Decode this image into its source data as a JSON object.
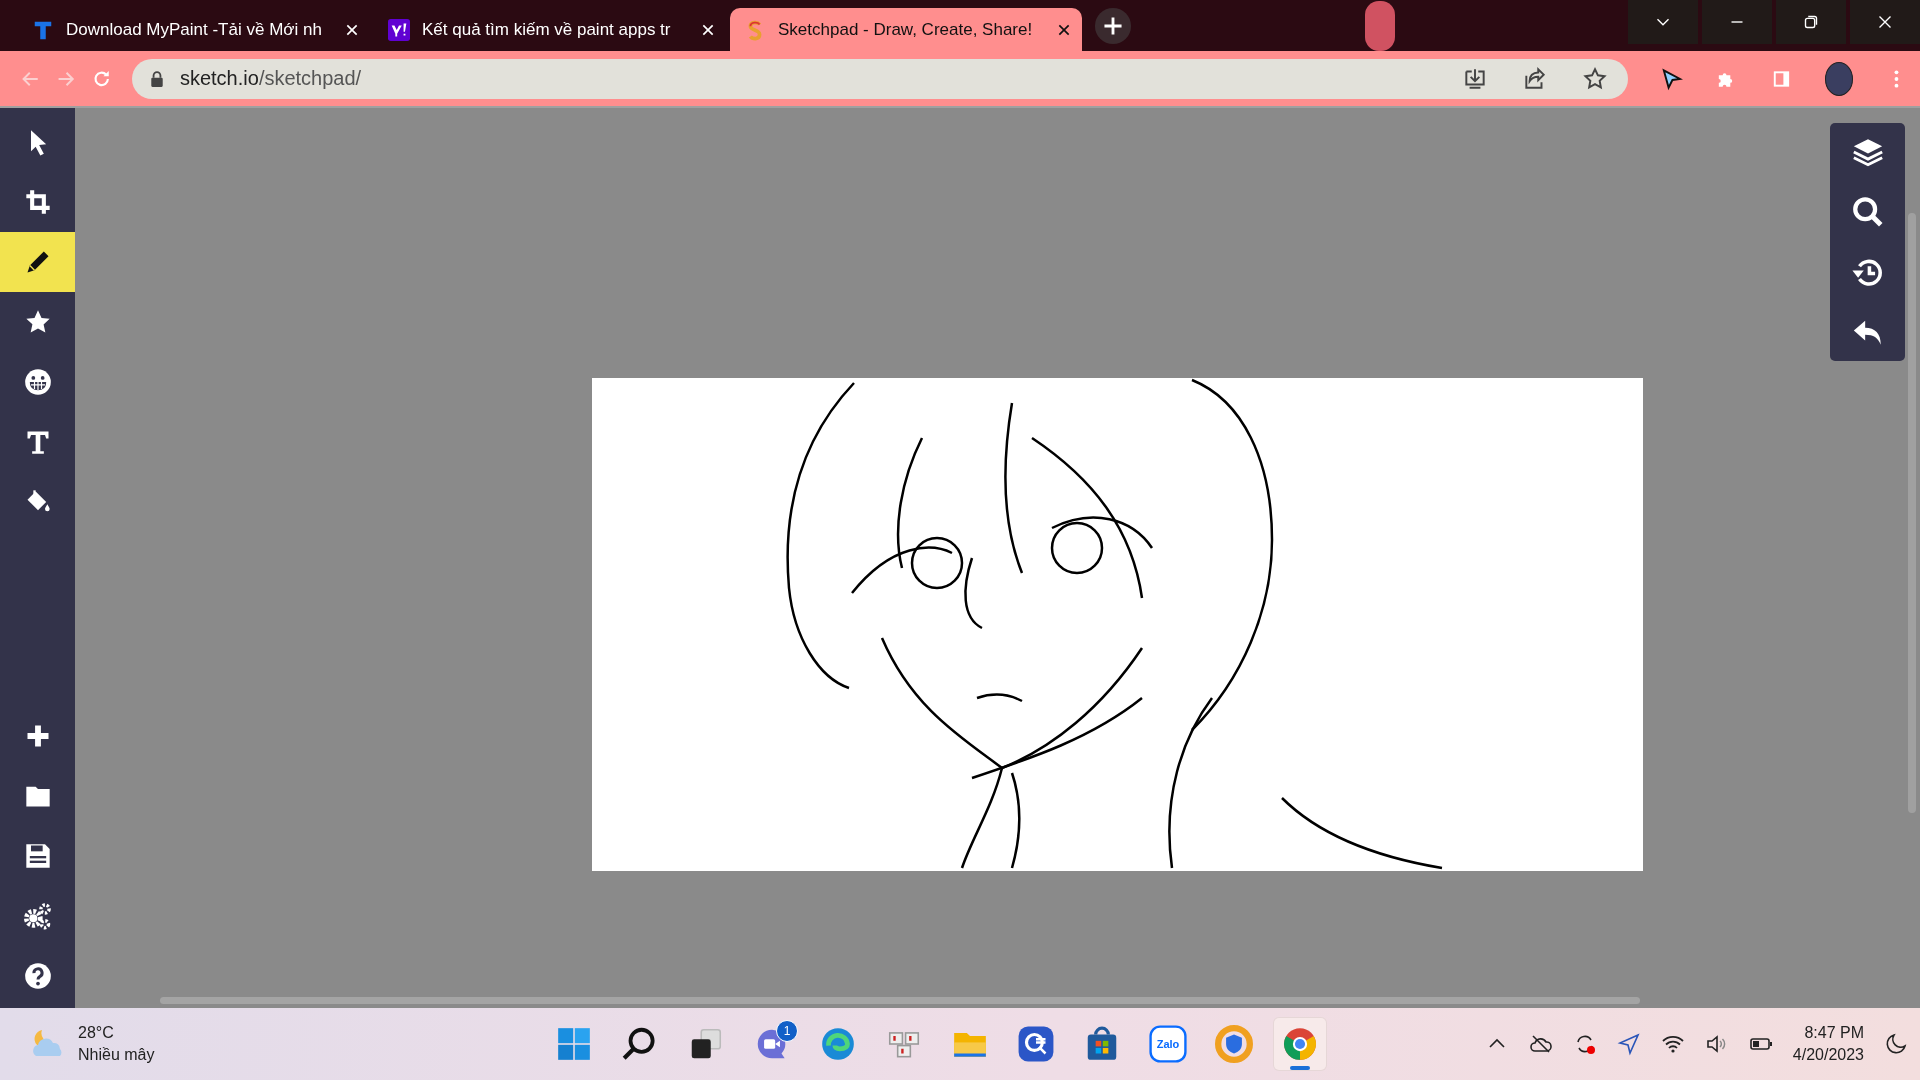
{
  "browser": {
    "tabs": [
      {
        "title": "Download MyPaint -Tải về Mới nh",
        "kind": "t",
        "selected": false
      },
      {
        "title": "Kết quả tìm kiếm về paint apps tr",
        "kind": "y",
        "selected": false
      },
      {
        "title": "Sketchpad - Draw, Create, Share!",
        "kind": "s",
        "selected": true
      }
    ],
    "url_host": "sketch.io",
    "url_path": "/sketchpad/"
  },
  "tools": [
    {
      "kind": "select",
      "selected": false
    },
    {
      "kind": "crop",
      "selected": false
    },
    {
      "kind": "pencil",
      "selected": true
    },
    {
      "kind": "star",
      "selected": false
    },
    {
      "kind": "emoji",
      "selected": false
    },
    {
      "kind": "text",
      "selected": false
    },
    {
      "kind": "fill",
      "selected": false
    }
  ],
  "taskbar": {
    "temperature": "28°C",
    "weather": "Nhiều mây",
    "apps": [
      {
        "kind": "start",
        "active": false
      },
      {
        "kind": "search",
        "active": false
      },
      {
        "kind": "taskview",
        "active": false
      },
      {
        "kind": "chat",
        "active": false,
        "badge": "1"
      },
      {
        "kind": "edge",
        "active": false
      },
      {
        "kind": "keyboard",
        "active": false
      },
      {
        "kind": "folder",
        "active": false
      },
      {
        "kind": "lens",
        "active": false
      },
      {
        "kind": "store",
        "active": false
      },
      {
        "kind": "zalo",
        "active": false,
        "label": "Zalo"
      },
      {
        "kind": "vpn",
        "active": false
      },
      {
        "kind": "chrome",
        "active": true
      }
    ],
    "time": "8:47 PM",
    "date": "4/20/2023"
  }
}
